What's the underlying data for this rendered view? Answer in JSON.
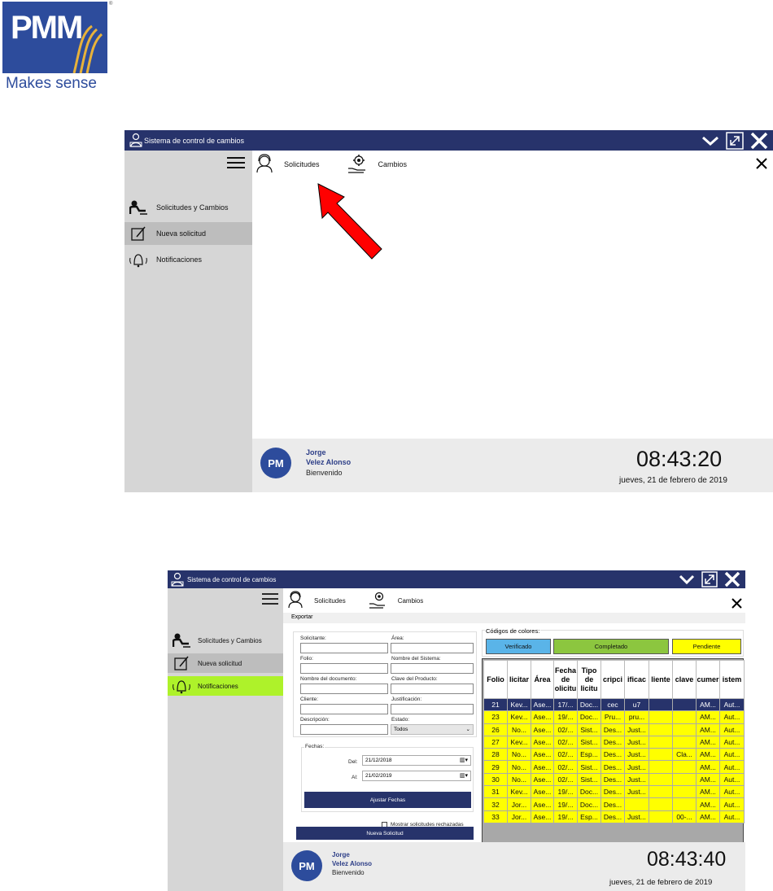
{
  "logo": {
    "brand": "PMM",
    "tagline": "Makes sense",
    "reg": "®"
  },
  "arrow_color": "#ff0000",
  "colors": {
    "titlebar": "#27336b",
    "sidebar": "#d6d6d6",
    "accent_green": "#aef22a",
    "legend_verified": "#5ab4e8",
    "legend_completed": "#8cc63f",
    "legend_pending": "#ffff00"
  },
  "window1": {
    "title": "Sistema de control de cambios",
    "tabs": [
      "Solicitudes",
      "Cambios"
    ],
    "sidebar": [
      {
        "label": "Solicitudes y Cambios",
        "icon": "person-desk-icon"
      },
      {
        "label": "Nueva solicitud",
        "icon": "edit-note-icon"
      },
      {
        "label": "Notificaciones",
        "icon": "bell-icon"
      }
    ],
    "user": {
      "first": "Jorge",
      "last": "Velez Alonso",
      "greeting": "Bienvenido"
    },
    "time": "08:43:20",
    "date": "jueves, 21 de febrero de 2019"
  },
  "window2": {
    "title": "Sistema de control de cambios",
    "tabs": [
      "Solicitudes",
      "Cambios"
    ],
    "menu_export": "Exportar",
    "sidebar": [
      {
        "label": "Solicitudes y Cambios",
        "icon": "person-desk-icon"
      },
      {
        "label": "Nueva solicitud",
        "icon": "edit-note-icon"
      },
      {
        "label": "Notificaciones",
        "icon": "bell-icon"
      }
    ],
    "form": {
      "solicitante": "Solicitante:",
      "area": "Área:",
      "folio": "Folio:",
      "nombre_sistema": "Nombre del Sistema:",
      "nombre_documento": "Nombre del documento:",
      "clave_producto": "Clave del Producto:",
      "cliente": "Cliente:",
      "justificacion": "Justificación:",
      "descripcion": "Descripción:",
      "estado": "Estado:",
      "estado_value": "Todos",
      "fechas": "Fechas:",
      "del": "Del:",
      "del_value": "21/12/2018",
      "al": "Al:",
      "al_value": "21/02/2019",
      "ajustar": "Ajustar Fechas",
      "mostrar": "Mostrar solicitudes rechazadas",
      "nueva": "Nueva Solicitud"
    },
    "legend": {
      "title": "Códigos de colores:",
      "verificado": "Verificado",
      "completado": "Completado",
      "pendiente": "Pendiente"
    },
    "table": {
      "headers": [
        "Folio",
        "licitar",
        "Área",
        "Fecha de olicitu",
        "Tipo de licitu",
        "cripci",
        "ificac",
        "liente",
        "clave",
        "cumer",
        "istem"
      ],
      "rows": [
        [
          "21",
          "Kev...",
          "Ase...",
          "17/...",
          "Doc...",
          "cec",
          "u7",
          "",
          "",
          "AM...",
          "Aut..."
        ],
        [
          "23",
          "Kev...",
          "Ase...",
          "19/...",
          "Doc...",
          "Pru...",
          "pru...",
          "",
          "",
          "AM...",
          "Aut..."
        ],
        [
          "26",
          "No...",
          "Ase...",
          "02/...",
          "Sist...",
          "Des...",
          "Just...",
          "",
          "",
          "AM...",
          "Aut..."
        ],
        [
          "27",
          "Kev...",
          "Ase...",
          "02/...",
          "Sist...",
          "Des...",
          "Just...",
          "",
          "",
          "AM...",
          "Aut..."
        ],
        [
          "28",
          "No...",
          "Ase...",
          "02/...",
          "Esp...",
          "Des...",
          "Just...",
          "",
          "Cla...",
          "AM...",
          "Aut..."
        ],
        [
          "29",
          "No...",
          "Ase...",
          "02/...",
          "Sist...",
          "Des...",
          "Just...",
          "",
          "",
          "AM...",
          "Aut..."
        ],
        [
          "30",
          "No...",
          "Ase...",
          "02/...",
          "Sist...",
          "Des...",
          "Just...",
          "",
          "",
          "AM...",
          "Aut..."
        ],
        [
          "31",
          "Kev...",
          "Ase...",
          "19/...",
          "Doc...",
          "Des...",
          "Just...",
          "",
          "",
          "AM...",
          "Aut..."
        ],
        [
          "32",
          "Jor...",
          "Ase...",
          "19/...",
          "Doc...",
          "Des...",
          "",
          "",
          "",
          "AM...",
          "Aut..."
        ],
        [
          "33",
          "Jor...",
          "Ase...",
          "19/...",
          "Esp...",
          "Des...",
          "Just...",
          "",
          "00-...",
          "AM...",
          "Aut..."
        ]
      ]
    },
    "user": {
      "first": "Jorge",
      "last": "Velez Alonso",
      "greeting": "Bienvenido"
    },
    "time": "08:43:40",
    "date": "jueves, 21 de febrero de 2019"
  }
}
